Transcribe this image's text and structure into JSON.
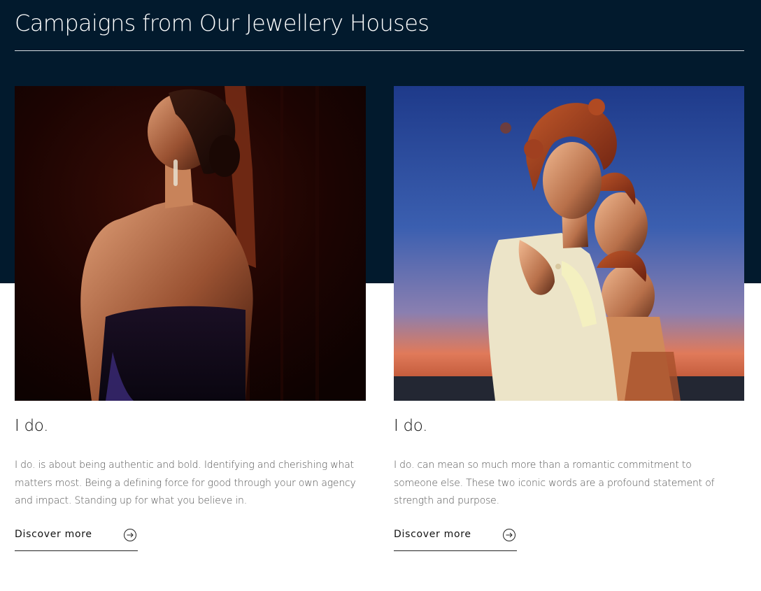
{
  "section": {
    "title": "Campaigns from Our Jewellery Houses"
  },
  "colors": {
    "band": "#021a2d",
    "text": "#111111",
    "body_text": "#555555"
  },
  "cards": [
    {
      "title": "I do.",
      "body": "I do. is about being authentic and bold. Identifying and cherishing what matters most. Being a defining force for good through your own agency and impact. Standing up for what you believe in.",
      "link_label": "Discover more",
      "link_icon": "arrow-right-circle-icon",
      "image": "woman-in-strapless-gown-photo"
    },
    {
      "title": "I do.",
      "body": "I do. can mean so much more than a romantic commitment to someone else. These two iconic words are a profound statement of strength and purpose.",
      "link_label": "Discover more",
      "link_icon": "arrow-right-circle-icon",
      "image": "three-women-at-sunset-photo"
    }
  ]
}
